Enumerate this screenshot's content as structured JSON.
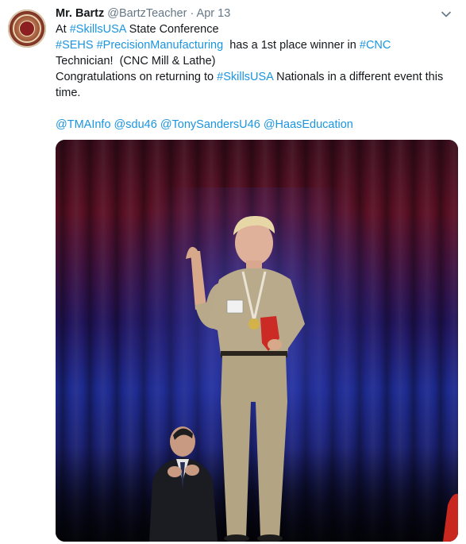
{
  "tweet": {
    "author_name": "Mr. Bartz",
    "author_handle": "@BartzTeacher",
    "separator": "·",
    "date": "Apr 13",
    "line1": {
      "pre": "At ",
      "tag": "#SkillsUSA",
      "post": " State Conference"
    },
    "line2": {
      "tag1": "#SEHS",
      "tag2": "#PrecisionManufacturing",
      "mid": "  has a 1st place winner in ",
      "tag3": "#CNC"
    },
    "line3": "Technician!  (CNC Mill & Lathe)",
    "line4": {
      "pre": "Congratulations on returning to ",
      "tag": "#SkillsUSA",
      "post": " Nationals in a different event this"
    },
    "line5": "time.",
    "mentions": [
      "@TMAInfo",
      "@sdu46",
      "@TonySandersU46",
      "@HaasEducation"
    ]
  },
  "icons": {
    "avatar": "school-seal-avatar",
    "menu": "chevron-down-icon"
  },
  "colors": {
    "link": "#1b95e0",
    "text": "#14171a",
    "muted": "#657786"
  }
}
